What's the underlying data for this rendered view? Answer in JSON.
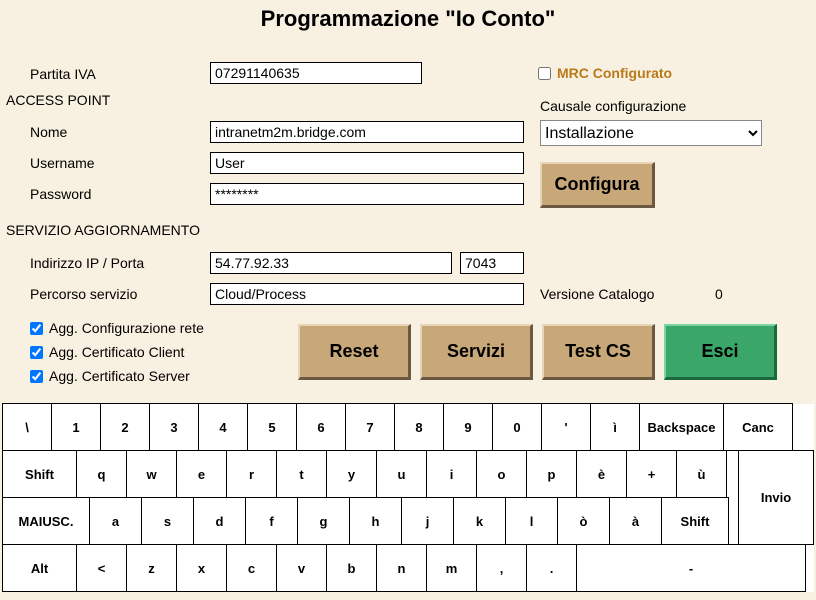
{
  "title": "Programmazione \"Io Conto\"",
  "labels": {
    "partita_iva": "Partita IVA",
    "access_point": "ACCESS POINT",
    "nome": "Nome",
    "username": "Username",
    "password": "Password",
    "servizio_agg": "SERVIZIO AGGIORNAMENTO",
    "indirizzo_ip": "Indirizzo IP / Porta",
    "percorso": "Percorso servizio",
    "causale": "Causale configurazione",
    "versione_catalogo": "Versione Catalogo",
    "mrc": "MRC Configurato",
    "agg_rete": "Agg. Configurazione rete",
    "agg_cert_client": "Agg. Certificato Client",
    "agg_cert_server": "Agg. Certificato Server"
  },
  "values": {
    "partita_iva": "07291140635",
    "nome": "intranetm2m.bridge.com",
    "username": "User",
    "password": "********",
    "ip": "54.77.92.33",
    "porta": "7043",
    "percorso": "Cloud/Process",
    "causale_selected": "Installazione",
    "versione_catalogo": "0",
    "mrc_checked": false,
    "agg_rete_checked": true,
    "agg_cert_client_checked": true,
    "agg_cert_server_checked": true
  },
  "buttons": {
    "configura": "Configura",
    "reset": "Reset",
    "servizi": "Servizi",
    "test_cs": "Test CS",
    "esci": "Esci"
  },
  "keyboard": {
    "row1": [
      "\\",
      "1",
      "2",
      "3",
      "4",
      "5",
      "6",
      "7",
      "8",
      "9",
      "0",
      "'",
      "ì",
      "Backspace",
      "Canc"
    ],
    "row2": [
      "Shift",
      "q",
      "w",
      "e",
      "r",
      "t",
      "y",
      "u",
      "i",
      "o",
      "p",
      "è",
      "+",
      "ù"
    ],
    "row3": [
      "MAIUSC.",
      "a",
      "s",
      "d",
      "f",
      "g",
      "h",
      "j",
      "k",
      "l",
      "ò",
      "à",
      "Shift"
    ],
    "row4": [
      "Alt",
      "<",
      "z",
      "x",
      "c",
      "v",
      "b",
      "n",
      "m",
      ",",
      ".",
      "-"
    ],
    "invio": "Invio"
  }
}
